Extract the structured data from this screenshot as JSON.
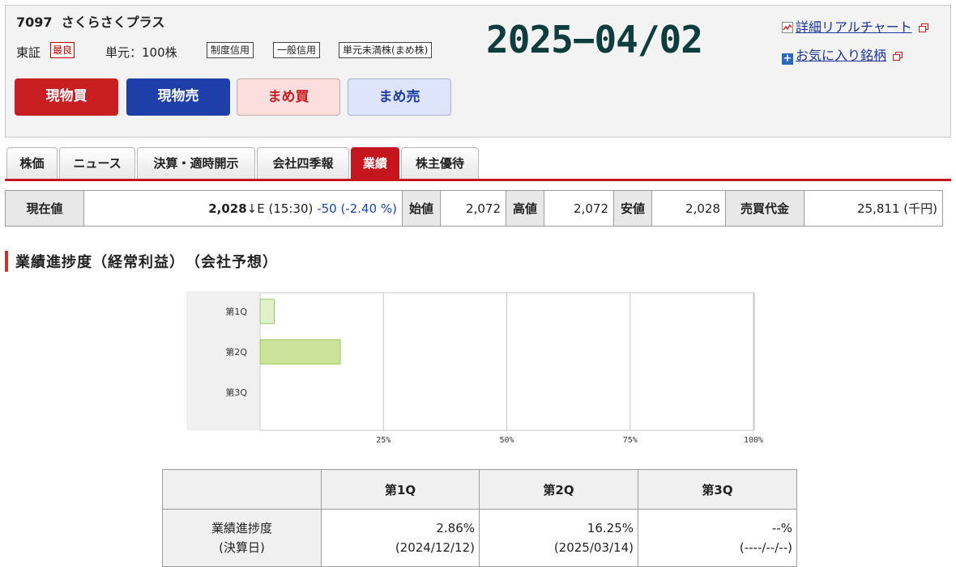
{
  "header": {
    "code": "7097",
    "name": "さくらさくプラス",
    "exchange": "東証",
    "market_badge": "最良",
    "unit": "単元：100株",
    "tags": [
      "制度信用",
      "一般信用",
      "単元未満株(まめ株)"
    ],
    "date_overlay": "2025−04/02",
    "links": [
      {
        "label": "詳細リアルチャート",
        "icon": "chart-icon"
      },
      {
        "label": "お気に入り銘柄",
        "icon": "plus-icon"
      }
    ],
    "buttons": {
      "spot_buy": "現物買",
      "spot_sell": "現物売",
      "mame_buy": "まめ買",
      "mame_sell": "まめ売"
    },
    "colors": {
      "spot_buy": "#c81e22",
      "spot_sell": "#1f3fa8",
      "mame_buy": "#fcdede",
      "mame_sell": "#dde4fb",
      "date_text": "#0d3d3d"
    }
  },
  "tabs": [
    "株価",
    "ニュース",
    "決算・適時開示",
    "会社四季報",
    "業績",
    "株主優待"
  ],
  "active_tab": "業績",
  "price": {
    "current_label": "現在値",
    "current_value": "2,028",
    "arrow": "↓",
    "status": "E (15:30)",
    "change": "-50 (-2.40 %)",
    "open_label": "始値",
    "open": "2,072",
    "high_label": "高値",
    "high": "2,072",
    "low_label": "安値",
    "low": "2,028",
    "turnover_label": "売買代金",
    "turnover": "25,811 (千円)"
  },
  "section_title": "業績進捗度（経常利益）　（会社予想）",
  "chart_data": {
    "type": "bar",
    "orientation": "horizontal",
    "categories": [
      "第1Q",
      "第2Q",
      "第3Q"
    ],
    "values": [
      2.86,
      16.25,
      null
    ],
    "xlim": [
      0,
      100
    ],
    "xticks": [
      "25%",
      "50%",
      "75%",
      "100%"
    ],
    "grid": true,
    "colors": [
      "#e1f0cd",
      "#cce49a"
    ]
  },
  "progress_table": {
    "headers": [
      "第1Q",
      "第2Q",
      "第3Q"
    ],
    "row_label_line1": "業績進捗度",
    "row_label_line2": "(決算日)",
    "values": [
      "2.86%",
      "16.25%",
      "--%"
    ],
    "dates": [
      "(2024/12/12)",
      "(2025/03/14)",
      "(----/--/--)"
    ]
  }
}
